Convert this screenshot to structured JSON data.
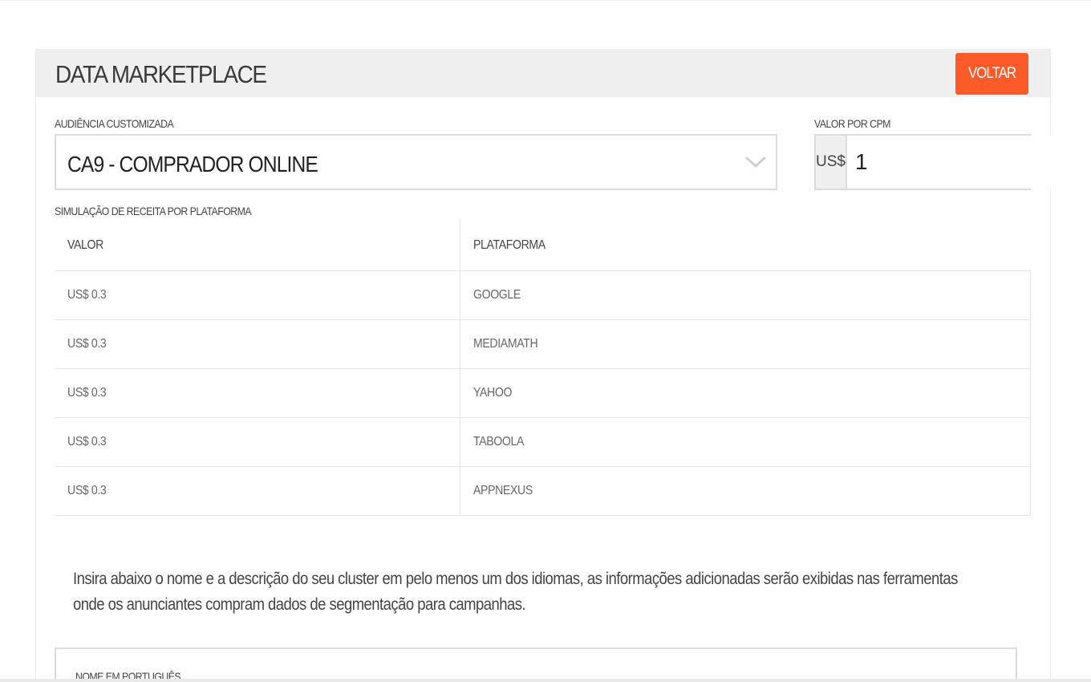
{
  "header": {
    "title": "DATA MARKETPLACE",
    "back_label": "VOLTAR"
  },
  "audience": {
    "label": "AUDIÊNCIA CUSTOMIZADA",
    "selected": "CA9 - COMPRADOR ONLINE"
  },
  "cpm": {
    "label": "VALOR POR CPM",
    "currency": "US$",
    "value": "1"
  },
  "simulation": {
    "label": "SIMULAÇÃO DE RECEITA POR PLATAFORMA",
    "columns": [
      "VALOR",
      "PLATAFORMA"
    ],
    "rows": [
      {
        "valor": "US$ 0.3",
        "plataforma": "GOOGLE"
      },
      {
        "valor": "US$ 0.3",
        "plataforma": "MEDIAMATH"
      },
      {
        "valor": "US$ 0.3",
        "plataforma": "YAHOO"
      },
      {
        "valor": "US$ 0.3",
        "plataforma": "TABOOLA"
      },
      {
        "valor": "US$ 0.3",
        "plataforma": "APPNEXUS"
      }
    ]
  },
  "info": {
    "text": "Insira abaixo o nome e a descrição do seu cluster em pelo menos um dos idiomas, as informações adicionadas serão exibidas nas ferramentas onde os anunciantes compram dados de segmentação para campanhas."
  },
  "name_section": {
    "label": "NOME EM PORTUGUÊS"
  },
  "colors": {
    "accent": "#fd5a2a",
    "header_bg": "#efefef",
    "border": "#dcdcdc"
  },
  "icons": {
    "select_chevron": "chevron-down-icon"
  }
}
